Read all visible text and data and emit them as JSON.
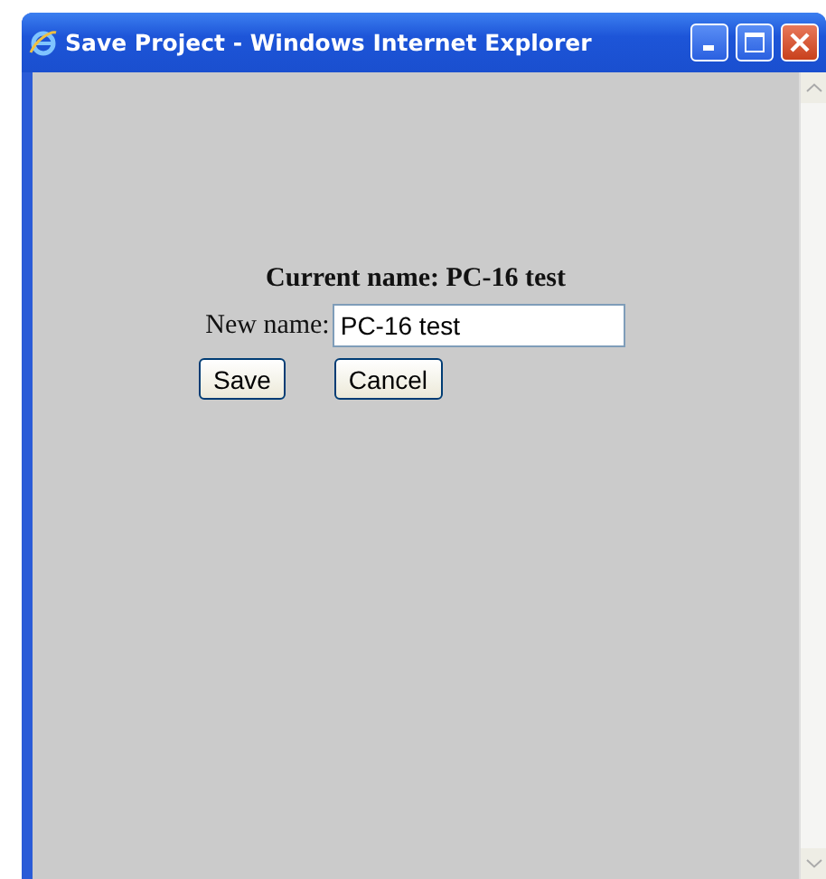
{
  "window": {
    "title": "Save Project - Windows Internet Explorer"
  },
  "form": {
    "current_name": "Current name: PC-16 test",
    "label": "New name:",
    "value": "PC-16 test",
    "buttons": [
      "Save",
      "Cancel"
    ]
  }
}
